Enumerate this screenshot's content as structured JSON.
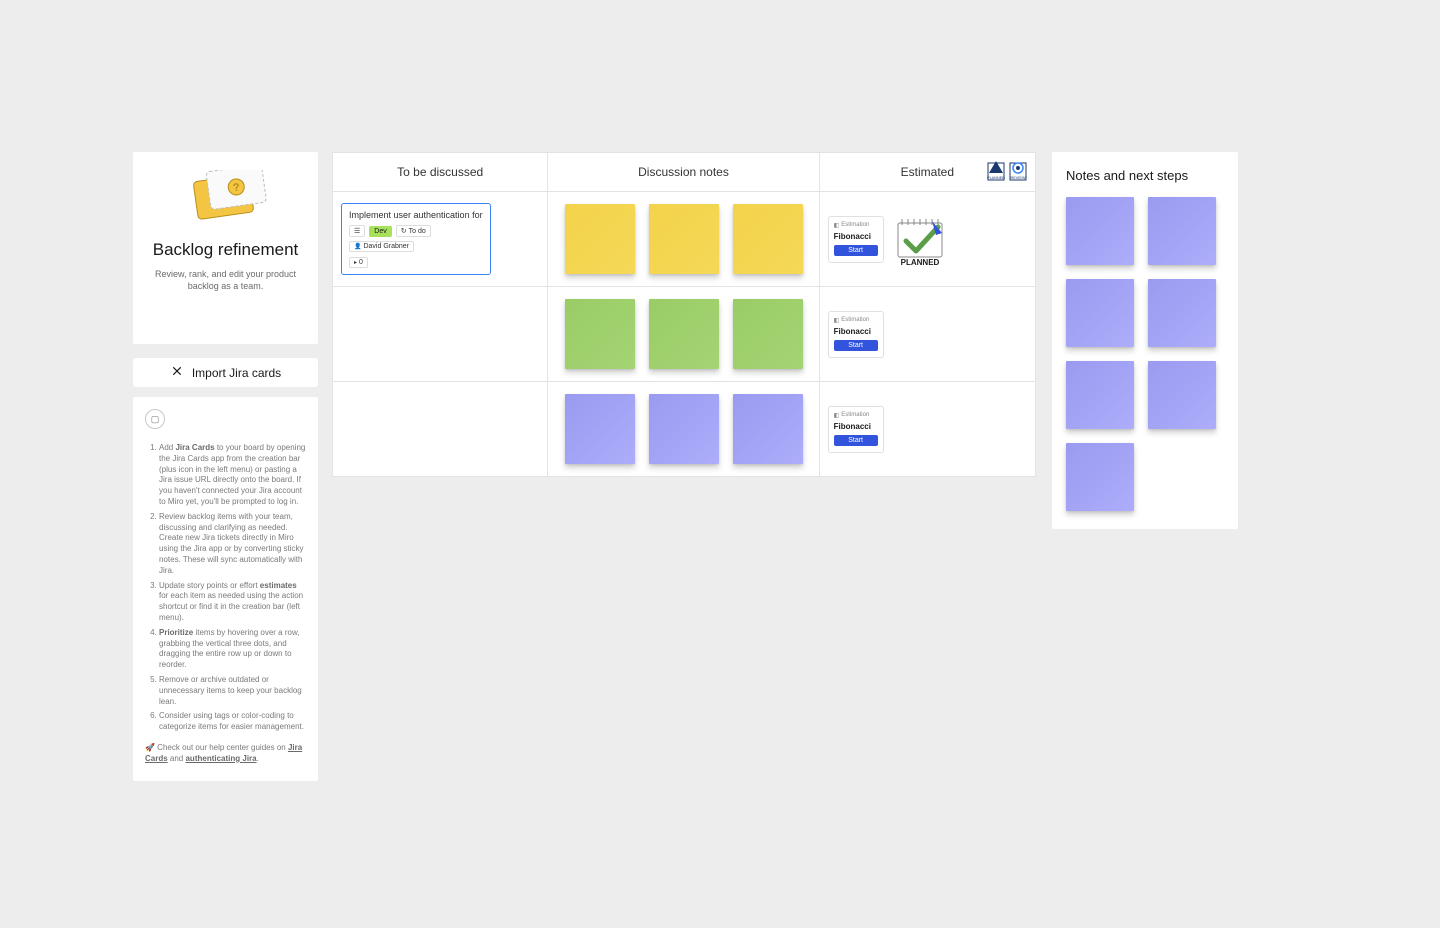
{
  "info": {
    "title": "Backlog refinement",
    "subtitle": "Review, rank, and edit your product backlog as a team."
  },
  "import_button": "Import Jira cards",
  "columns": {
    "a": "To be discussed",
    "b": "Discussion notes",
    "c": "Estimated"
  },
  "badges": {
    "planned": "PLANNED",
    "review": "REVIEW"
  },
  "jira_card": {
    "title": "Implement user authentication for",
    "tag_dev": "Dev",
    "status": "To do",
    "assignee": "David Grabner",
    "expand_count": "0"
  },
  "estimation": {
    "label": "Estimation",
    "name": "Fibonacci",
    "button": "Start"
  },
  "planned_label": "PLANNED",
  "notes": {
    "title": "Notes and next steps"
  },
  "instructions": {
    "items": [
      {
        "pre": "Add ",
        "bold": "Jira Cards",
        "post": " to your board by opening the Jira Cards app from the creation bar (plus icon in the left menu) or pasting a Jira issue URL directly onto the board. If you haven't connected your Jira account to Miro yet, you'll be prompted to log in."
      },
      {
        "pre": "",
        "bold": "",
        "post": "Review backlog items with your team, discussing and clarifying as needed. Create new Jira tickets directly in Miro using the Jira app or by converting sticky notes. These will sync automatically with Jira."
      },
      {
        "pre": "Update story points or effort ",
        "bold": "estimates",
        "post": " for each item as needed using the action shortcut or find it in the creation bar (left menu)."
      },
      {
        "pre": "",
        "bold": "Prioritize",
        "post": " items by hovering over a row, grabbing the vertical three dots, and dragging the entire row up or down to reorder."
      },
      {
        "pre": "",
        "bold": "",
        "post": "Remove or archive outdated or unnecessary items to keep your backlog lean."
      },
      {
        "pre": "",
        "bold": "",
        "post": "Consider using tags or color-coding to categorize items for easier management."
      }
    ],
    "footer_pre": "🚀 Check out our help center guides on ",
    "footer_link1": "Jira Cards",
    "footer_mid": " and ",
    "footer_link2": "authenticating Jira",
    "footer_post": "."
  }
}
